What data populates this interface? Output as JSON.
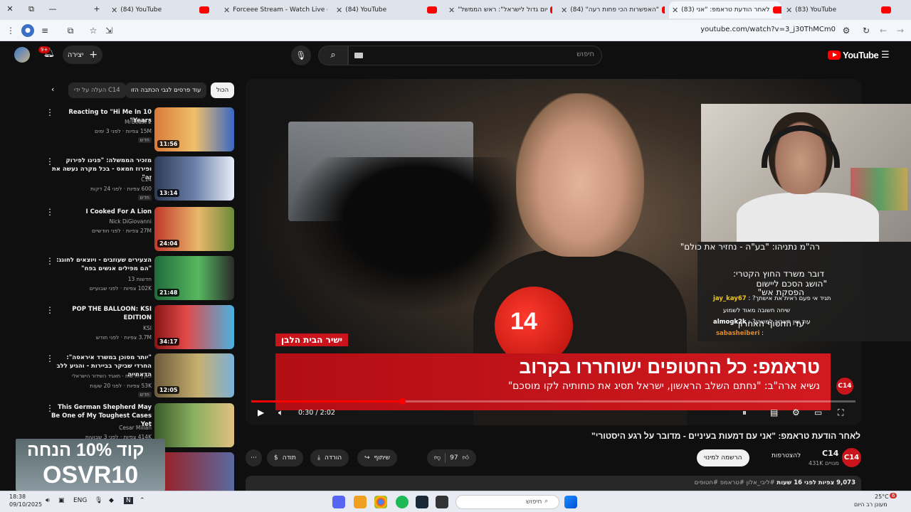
{
  "browser": {
    "tabs": [
      {
        "label": "(84) YouTube",
        "icon": "youtube-icon"
      },
      {
        "label": "Forceee Stream - Watch Live o",
        "icon": "kick-icon"
      },
      {
        "label": "(84) YouTube",
        "icon": "youtube-icon"
      },
      {
        "label": "\"יום גדול לישראל\": ראש הממשל",
        "icon": "youtube-icon"
      },
      {
        "label": "(84) \"האפשרות הכי פחות רעה\"",
        "icon": "youtube-icon"
      },
      {
        "label": "(83) לאחר הודעת טראמפ: \"אני",
        "icon": "youtube-icon"
      },
      {
        "label": "(83) YouTube",
        "icon": "youtube-icon"
      }
    ],
    "url": "youtube.com/watch?v=3_j30ThMCm0",
    "window_buttons": [
      "✕",
      "⧉",
      "—",
      "+"
    ]
  },
  "yt_header": {
    "search_placeholder": "חיפוש",
    "create_label": "יצירה",
    "notif_count": "9+",
    "logo_text": "YouTube"
  },
  "chips": [
    "הכול",
    "עוד פרסים לגבי הכתבה הזו",
    "העלה על ידי C14"
  ],
  "related": [
    {
      "title": "Reacting to \"Hi Me In 10 Years\"",
      "channel": "MrBeast 2",
      "meta": "15M צפיות · לפני 3 ימים",
      "badge": "חדש",
      "duration": "11:56"
    },
    {
      "title": "מזכיר הממשלה: \"פנינו לפירוק ופירוז חמאס - בכל מקרה נעשה את זה\"",
      "channel": "C14",
      "meta": "600 צפיות · לפני 24 דקות",
      "badge": "חדש",
      "duration": "13:14"
    },
    {
      "title": "I Cooked For A Lion",
      "channel": "Nick DiGiovanni",
      "meta": "27M צפיות · לפני חודשיים",
      "badge": "",
      "duration": "24:04"
    },
    {
      "title": "הצעירים שעוזבים - ויוצאים לחוגג: \"הם מפילים אנשים בפח\"",
      "channel": "חדשות 13",
      "meta": "102K צפיות · לפני שבועיים",
      "badge": "",
      "duration": "21:48"
    },
    {
      "title": "POP THE BALLOON: KSI EDITION",
      "channel": "KSI",
      "meta": "3.7M צפיות · לפני חודש",
      "badge": "",
      "duration": "34:17"
    },
    {
      "title": "\"יותר מסוכן במשרד איראסה\": החרדי שביקר בביירות - והגיע ללב הדאחייה",
      "channel": "כאן | חדשות - תאגיד השידור הישראלי",
      "meta": "53K צפיות · לפני 20 שעות",
      "badge": "חדש",
      "duration": "12:05"
    },
    {
      "title": "This German Shepherd May Be One of My Toughest Cases Yet",
      "channel": "Cesar Millan",
      "meta": "414K צפיות · לפני 3 שבועות",
      "badge": "",
      "duration": ""
    }
  ],
  "player": {
    "lower_tag": "ישיר הבית הלבן",
    "headline": "טראמפ: כל החטופים ישוחררו בקרוב",
    "subline": "נשיא ארה\"ב: \"נחתם השלב הראשון, ישראל תסיג את כוחותיה לקו מוסכם\"",
    "bug": "C14",
    "time": "0:30 / 2:02",
    "progress": 0.25
  },
  "stream_overlay": {
    "news_lines": [
      "רה\"מ נתניהו: \"בע\"ה - נחזיר את כולם\"",
      "דובר משרד החוץ הקטרי:",
      "\"הושג הסכם ליישום",
      "הפסקת אש\"",
      "עד החטוף האחרון\""
    ],
    "chat": [
      {
        "user": "jay_kay67",
        "text": "תגיד אי פעם ראית את אישתך?"
      },
      {
        "user": "",
        "text": "שיחה חשובה מאוד לשמוע"
      },
      {
        "user": "almogk2k",
        "text": "עוד אין תאריך למשהו?"
      },
      {
        "user": "sabasheiberi",
        "text": ":"
      }
    ]
  },
  "video": {
    "title": "לאחר הודעת טראמפ: \"אני עם דמעות בעיניים - מדובר על רגע היסטורי\"",
    "channel": "C14",
    "subs": "431K מנויים",
    "join": "להצטרפות",
    "subscribe": "הרשמה למינוי",
    "likes": "97",
    "share": "שיתוף",
    "download": "הורדה",
    "thanks": "תודה",
    "views": "9,073 צפיות",
    "age": "לפני 16 שעות",
    "tags": "#ליבי_אלון #טראמפ #חטופים"
  },
  "promo": {
    "line1": "קוד 10% הנחה",
    "line2": "OSVR10"
  },
  "taskbar": {
    "time": "18:38",
    "date": "09/10/2025",
    "lang": "ENG",
    "search": "חיפוש",
    "temp": "25°C",
    "weather": "מעונן רב היום",
    "badge": "6"
  }
}
